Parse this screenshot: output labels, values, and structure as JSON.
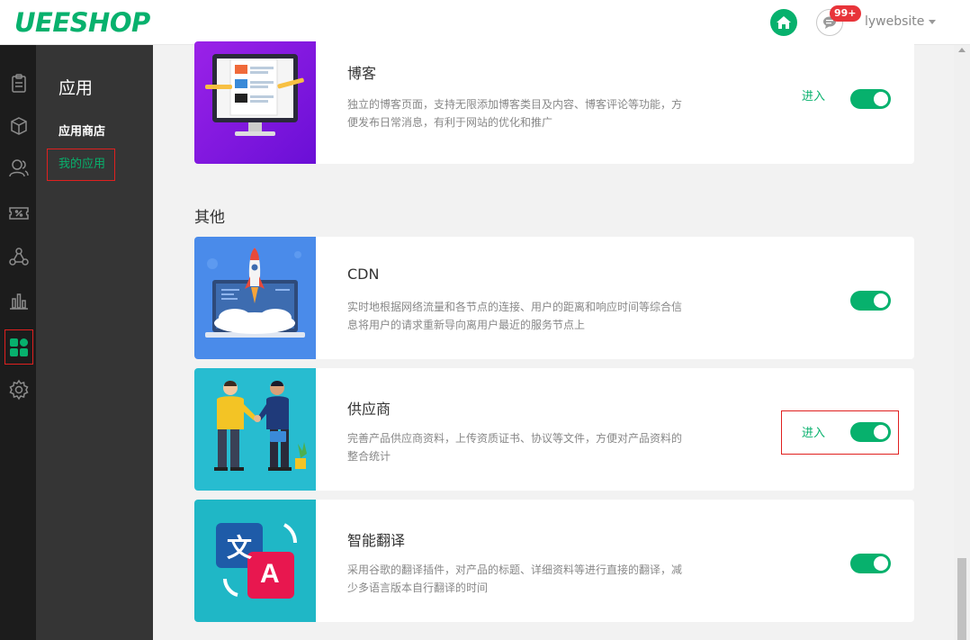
{
  "header": {
    "logo": "UEESHOP",
    "badge": "99+",
    "username": "lywebsite",
    "home_icon": "home-icon",
    "message_icon": "chat-icon",
    "accent": "#07b16d"
  },
  "iconbar": {
    "items": [
      "clipboard-icon",
      "box-icon",
      "users-icon",
      "coupon-icon",
      "share-nodes-icon",
      "bar-chart-icon",
      "apps-icon",
      "gear-icon"
    ],
    "active": "apps-icon"
  },
  "subnav": {
    "title": "应用",
    "store": "应用商店",
    "mine": "我的应用"
  },
  "main": {
    "section_title": "其他",
    "apps": [
      {
        "title": "博客",
        "desc": "独立的博客页面，支持无限添加博客类目及内容、博客评论等功能，方便发布日常消息，有利于网站的优化和推广",
        "enter": "进入",
        "enabled": true
      },
      {
        "title": "CDN",
        "desc": "实时地根据网络流量和各节点的连接、用户的距离和响应时间等综合信息将用户的请求重新导向离用户最近的服务节点上",
        "enter": "",
        "enabled": true
      },
      {
        "title": "供应商",
        "desc": "完善产品供应商资料，上传资质证书、协议等文件，方便对产品资料的整合统计",
        "enter": "进入",
        "enabled": true
      },
      {
        "title": "智能翻译",
        "desc": "采用谷歌的翻译插件，对产品的标题、详细资料等进行直接的翻译，减少多语言版本自行翻译的时间",
        "enter": "",
        "enabled": true
      }
    ],
    "translate_thumb": {
      "zh": "文",
      "en": "A"
    }
  }
}
